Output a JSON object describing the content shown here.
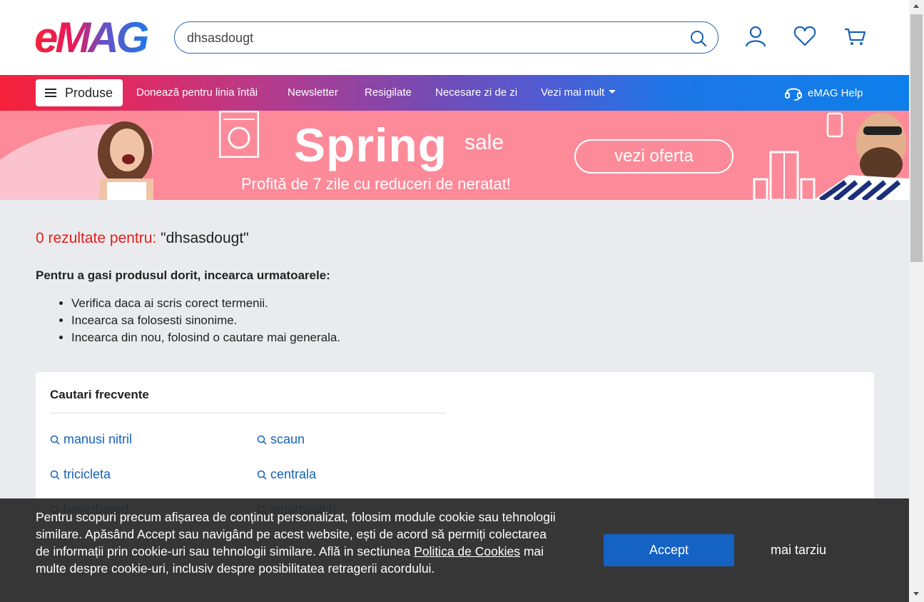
{
  "header": {
    "logo_text": "eMAG",
    "search_value": "dhsasdougt"
  },
  "nav": {
    "produse": "Produse",
    "links": [
      "Donează pentru linia întâi",
      "Newsletter",
      "Resigilate",
      "Necesare zi de zi",
      "Vezi mai mult"
    ],
    "help": "eMAG Help"
  },
  "banner": {
    "title": "Spring",
    "tag": "sale",
    "subtitle": "Profită de 7 zile cu reduceri de neratat!",
    "cta": "vezi oferta"
  },
  "results": {
    "count_text": "0 rezultate pentru:",
    "query_text": "\"dhsasdougt\"",
    "tips_heading": "Pentru a gasi produsul dorit, incearca urmatoarele:",
    "tips": [
      "Verifica daca ai scris corect termenii.",
      "Incearca sa folosesti sinonime.",
      "Incearca din nou, folosind o cautare mai generala."
    ]
  },
  "frequent": {
    "title": "Cautari frecvente",
    "items": [
      "manusi nitril",
      "scaun",
      "tricicleta",
      "centrala",
      "hoverboard",
      "smartwatch"
    ]
  },
  "cookie": {
    "text_before": "Pentru scopuri precum afișarea de conținut personalizat, folosim module cookie sau tehnologii similare. Apăsând Accept sau navigând pe acest website, ești de acord să permiți colectarea de informații prin cookie-uri sau tehnologii similare. Află in sectiunea",
    "link": "Politica de Cookies",
    "text_after": "mai multe despre cookie-uri, inclusiv despre posibilitatea retragerii acordului.",
    "accept": "Accept",
    "later": "mai tarziu"
  },
  "colors": {
    "accent_red": "#e3201b",
    "link_blue": "#1662b8",
    "button_blue": "#1462c4"
  },
  "icons": [
    "search-icon",
    "user-icon",
    "heart-icon",
    "cart-icon",
    "menu-icon",
    "headset-icon",
    "caret-down-icon"
  ]
}
